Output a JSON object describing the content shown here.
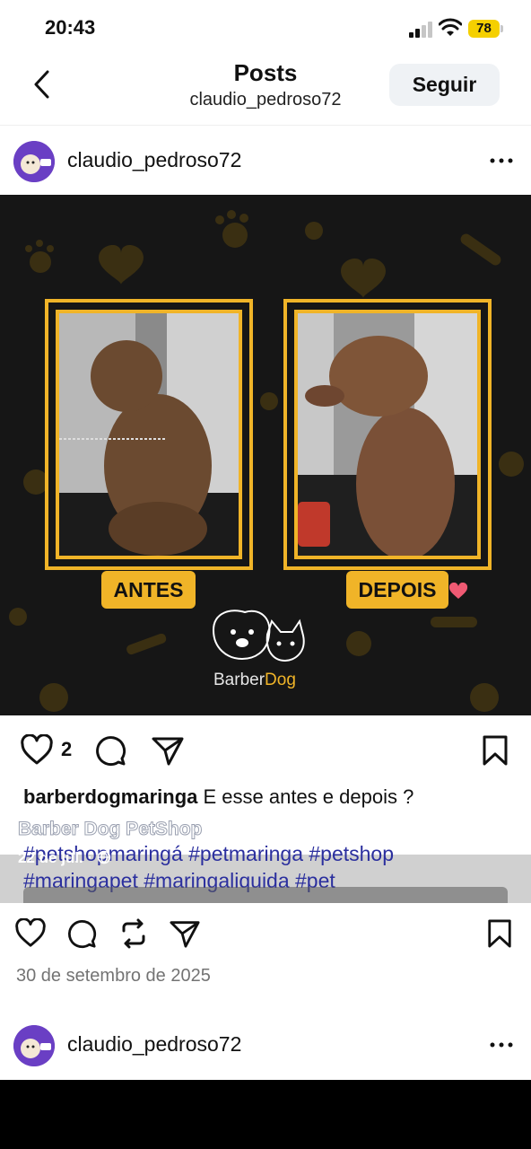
{
  "status_bar": {
    "time": "20:43",
    "battery": "78"
  },
  "nav": {
    "title": "Posts",
    "subtitle": "claudio_pedroso72",
    "follow_label": "Seguir"
  },
  "post1": {
    "username": "claudio_pedroso72",
    "image": {
      "before_label": "ANTES",
      "after_label": "DEPOIS",
      "brand_a": "Barber",
      "brand_b": "Dog"
    },
    "likes": "2",
    "caption_user": "barberdogmaringa",
    "caption_text": " E esse antes e depois ?",
    "hashtags_line1": "#petshopmaringá #petmaringa #petshop",
    "hashtags_line2": "#maringapet #maringaliquida #pet",
    "overlay_title": "Barber Dog PetShop",
    "overlay_date": "22 de jul. · ",
    "date": "30 de setembro de 2025"
  },
  "post2": {
    "username": "claudio_pedroso72"
  },
  "icons": [
    "back-icon",
    "more-icon",
    "heart-icon",
    "comment-icon",
    "share-icon",
    "bookmark-icon",
    "repost-icon"
  ],
  "colors": {
    "accent_gold": "#f0b428",
    "follow_bg": "#eff2f5",
    "hashtag": "#2b2f9e",
    "avatar": "#6a3fc4"
  }
}
